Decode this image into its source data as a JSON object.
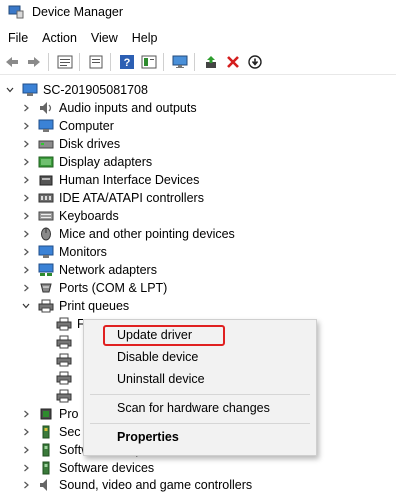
{
  "window": {
    "title": "Device Manager"
  },
  "menu": {
    "items": [
      "File",
      "Action",
      "View",
      "Help"
    ]
  },
  "toolbar": {
    "buttons": [
      "back-icon",
      "forward-icon",
      "properties-icon",
      "view-icon",
      "help-icon",
      "view2-icon",
      "scan-icon",
      "update-driver-icon",
      "uninstall-icon",
      "disable-icon"
    ]
  },
  "tree": {
    "root": "SC-201905081708",
    "categories": [
      "Audio inputs and outputs",
      "Computer",
      "Disk drives",
      "Display adapters",
      "Human Interface Devices",
      "IDE ATA/ATAPI controllers",
      "Keyboards",
      "Mice and other pointing devices",
      "Monitors",
      "Network adapters",
      "Ports (COM & LPT)",
      "Print queues"
    ],
    "print_queue_children_visible_fragment": "Fa",
    "lower_categories": [
      "Pro",
      "Sec",
      "Software components",
      "Software devices",
      "Sound, video and game controllers"
    ]
  },
  "context_menu": {
    "update_driver": "Update driver",
    "disable_device": "Disable device",
    "uninstall_device": "Uninstall device",
    "scan": "Scan for hardware changes",
    "properties": "Properties"
  },
  "colors": {
    "highlight_border": "#e02020",
    "menu_bg": "#f2f2f2"
  }
}
